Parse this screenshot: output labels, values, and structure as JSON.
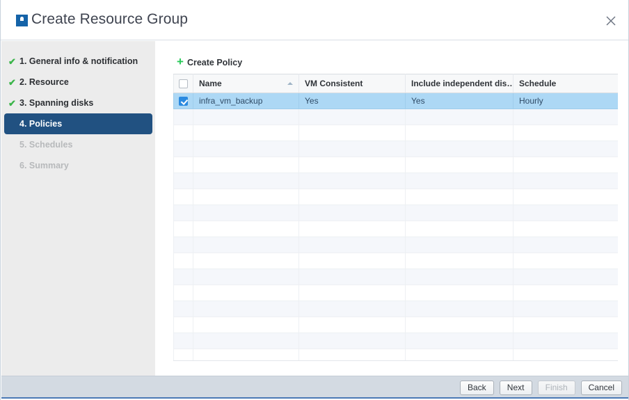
{
  "window": {
    "title": "Create Resource Group",
    "icon": "app-logo-icon",
    "close_icon": "close-icon"
  },
  "sidebar": {
    "steps": [
      {
        "label": "1. General info & notification",
        "state": "done",
        "check": "✔"
      },
      {
        "label": "2. Resource",
        "state": "done",
        "check": "✔"
      },
      {
        "label": "3. Spanning disks",
        "state": "done",
        "check": "✔"
      },
      {
        "label": "4. Policies",
        "state": "active",
        "check": ""
      },
      {
        "label": "5. Schedules",
        "state": "todo",
        "check": ""
      },
      {
        "label": "6. Summary",
        "state": "todo",
        "check": ""
      }
    ]
  },
  "toolbar": {
    "create_policy_label": "Create Policy",
    "create_policy_plus": "+"
  },
  "table": {
    "columns": [
      {
        "key": "chk",
        "label": ""
      },
      {
        "key": "name",
        "label": "Name",
        "sort": "asc"
      },
      {
        "key": "vm_consistent",
        "label": "VM Consistent"
      },
      {
        "key": "include_independent_disks",
        "label": "Include independent dis…"
      },
      {
        "key": "schedule",
        "label": "Schedule"
      }
    ],
    "header_checkbox_checked": false,
    "rows": [
      {
        "selected": true,
        "checked": true,
        "name": "infra_vm_backup",
        "vm_consistent": "Yes",
        "include_independent_disks": "Yes",
        "schedule": "Hourly"
      }
    ],
    "empty_row_count": 16
  },
  "footer": {
    "buttons": [
      {
        "label": "Back",
        "disabled": false
      },
      {
        "label": "Next",
        "disabled": false
      },
      {
        "label": "Finish",
        "disabled": true
      },
      {
        "label": "Cancel",
        "disabled": false
      }
    ]
  },
  "colors": {
    "accent_blue": "#215181",
    "check_green": "#3bb54a",
    "plus_green": "#26c957",
    "selection_blue": "#add8f5",
    "checkbox_blue": "#2b8ae0",
    "footer_bar": "#d3dae2",
    "footer_underline": "#4a79b5",
    "sidebar_bg": "#ececec",
    "link_text": "#3a6fa5"
  }
}
